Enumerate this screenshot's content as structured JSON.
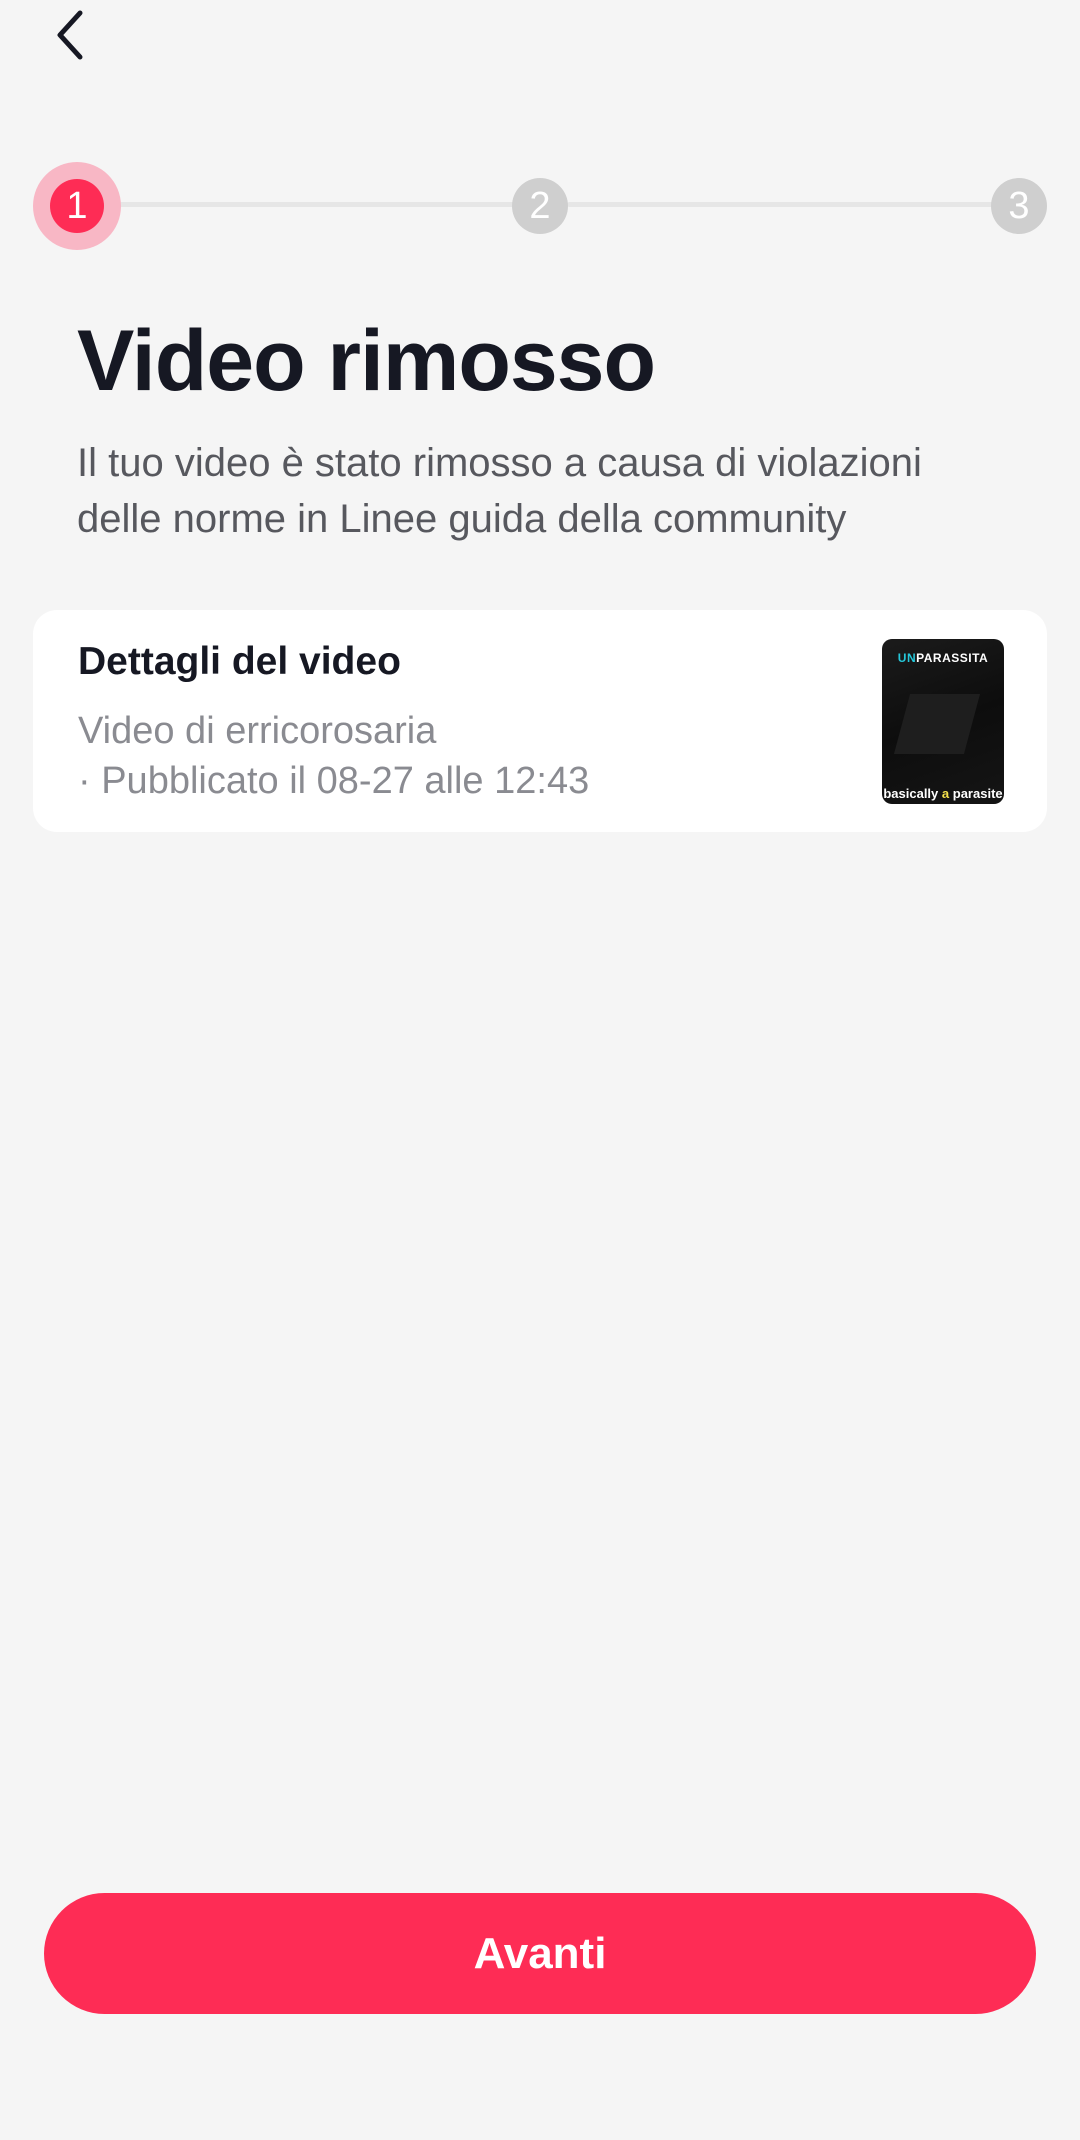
{
  "header": {
    "back_icon": "chevron-left-icon"
  },
  "stepper": {
    "steps": [
      "1",
      "2",
      "3"
    ],
    "current_step": 1,
    "active_color": "#fe2c55",
    "inactive_color": "#cfcfcf"
  },
  "main": {
    "title": "Video rimosso",
    "subtitle": "Il tuo video è stato rimosso a causa di violazioni delle norme in Linee guida della community"
  },
  "video_card": {
    "title": "Dettagli del video",
    "author_line": "Video di erricorosaria",
    "published_line": "· Pubblicato il 08-27 alle 12:43",
    "thumbnail": {
      "top_text_prefix": "UN",
      "top_text_rest": "PARASSITA",
      "bottom_text_prefix": "basically",
      "bottom_text_highlight": "a",
      "bottom_text_rest": "parasite"
    }
  },
  "footer": {
    "next_label": "Avanti",
    "accent_color": "#fe2c55"
  }
}
